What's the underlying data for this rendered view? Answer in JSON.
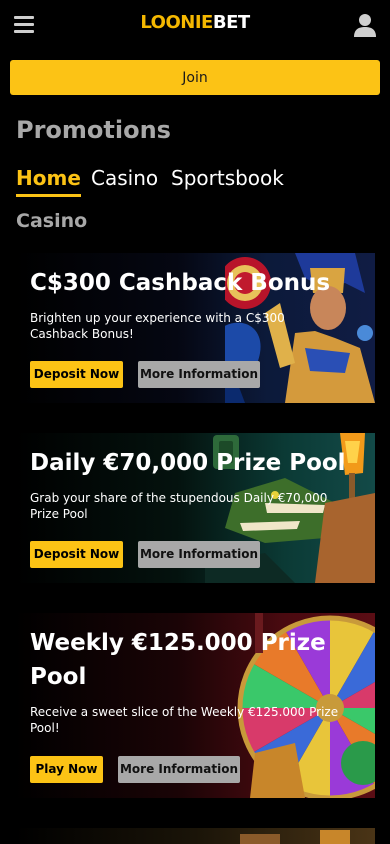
{
  "header": {
    "logo_prefix": "LOONIE",
    "logo_suffix": "BET",
    "menu_icon": "hamburger-menu-icon",
    "profile_icon": "user-profile-icon"
  },
  "join": {
    "label": "Join"
  },
  "page": {
    "title": "Promotions",
    "section_heading": "Casino"
  },
  "tabs": [
    {
      "label": "Home",
      "active": true
    },
    {
      "label": "Casino",
      "active": false
    },
    {
      "label": "Sportsbook",
      "active": false
    }
  ],
  "promotions": [
    {
      "title": "C$300 Cashback Bonus",
      "description": "Brighten up your experience with a C$300 Cashback Bonus!",
      "primary_label": "Deposit Now",
      "secondary_label": "More Information",
      "art": "egyptian-queen-slot-art"
    },
    {
      "title": "Daily €70,000 Prize Pool",
      "description": "Grab your share of the stupendous Daily €70,000 Prize Pool",
      "primary_label": "Deposit Now",
      "secondary_label": "More Information",
      "art": "crocodile-torch-slot-art"
    },
    {
      "title": "Weekly €125.000 Prize Pool",
      "description": "Receive a sweet slice of the Weekly €125.000 Prize Pool!",
      "primary_label": "Play Now",
      "secondary_label": "More Information",
      "art": "prize-wheel-art"
    }
  ],
  "colors": {
    "accent": "#fcc315",
    "background": "#000000",
    "muted_heading": "#a8a8a8",
    "secondary_button": "#a8a8a8"
  }
}
